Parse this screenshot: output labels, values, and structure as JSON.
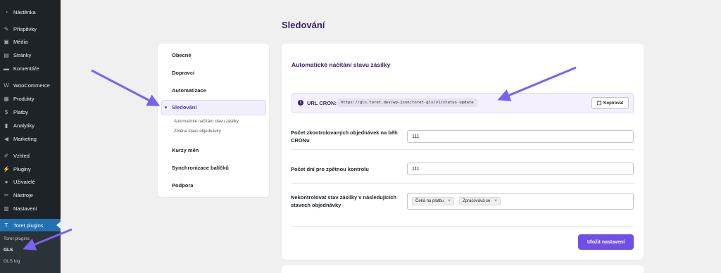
{
  "sidebar": {
    "items": [
      {
        "label": "Nástěnka",
        "icon": "dashboard-icon",
        "glyph": "◔"
      },
      {
        "label": "Příspěvky",
        "icon": "pin-icon",
        "glyph": "✎"
      },
      {
        "label": "Média",
        "icon": "media-icon",
        "glyph": "▣"
      },
      {
        "label": "Stránky",
        "icon": "pages-icon",
        "glyph": "▤"
      },
      {
        "label": "Komentáře",
        "icon": "comments-icon",
        "glyph": "▬"
      },
      {
        "label": "WooCommerce",
        "icon": "woocommerce-icon",
        "glyph": "W"
      },
      {
        "label": "Produkty",
        "icon": "products-icon",
        "glyph": "▦"
      },
      {
        "label": "Platby",
        "icon": "payments-icon",
        "glyph": "$"
      },
      {
        "label": "Analytiky",
        "icon": "analytics-icon",
        "glyph": "▮"
      },
      {
        "label": "Marketing",
        "icon": "megaphone-icon",
        "glyph": "◀"
      },
      {
        "label": "Vzhled",
        "icon": "appearance-icon",
        "glyph": "✐"
      },
      {
        "label": "Pluginy",
        "icon": "plugins-icon",
        "glyph": "⚡"
      },
      {
        "label": "Uživatelé",
        "icon": "users-icon",
        "glyph": "●"
      },
      {
        "label": "Nástroje",
        "icon": "tools-icon",
        "glyph": "✂"
      },
      {
        "label": "Nastavení",
        "icon": "settings-icon",
        "glyph": "▥"
      },
      {
        "label": "Toret plugins",
        "icon": "toret-icon",
        "glyph": "T"
      }
    ],
    "submenu": [
      "Toret plugins",
      "GLS",
      "GLS log"
    ]
  },
  "page": {
    "title": "Sledování"
  },
  "settings_nav": {
    "items": [
      "Obecné",
      "Dopravci",
      "Automatizace",
      "Sledování",
      "Kurzy měn",
      "Synchronizace balíčků",
      "Podpora"
    ],
    "active": "Sledování",
    "subitems": [
      "Automatické načítání stavu zásilky",
      "Změna stavu objednávky"
    ]
  },
  "main": {
    "section_title": "Automatické načítání stavu zásilky",
    "url_label": "URL CRON:",
    "url_value": "https://gls.toret.dev/wp-json/toret-gls/v1/status-update",
    "copy_label": "Kopírovat",
    "fields": [
      {
        "label": "Počet zkontrolovaných objednávek na běh CRONu",
        "value": "111"
      },
      {
        "label": "Počet dní pro zpětnou kontrolu",
        "value": "111"
      }
    ],
    "exclude_label": "Nekontrolovat stav zásilky v následujících stavech objednávky",
    "tags": [
      "Čeká na platbu",
      "Zpracovává se"
    ],
    "tag_remove": "×",
    "save_label": "Uložit nastavení"
  },
  "colors": {
    "accent": "#6e50e6",
    "title": "#3a2367",
    "sidebar": "#1d2327",
    "sidebar_active": "#2271b1",
    "annotation_arrow": "#7b61f0"
  }
}
